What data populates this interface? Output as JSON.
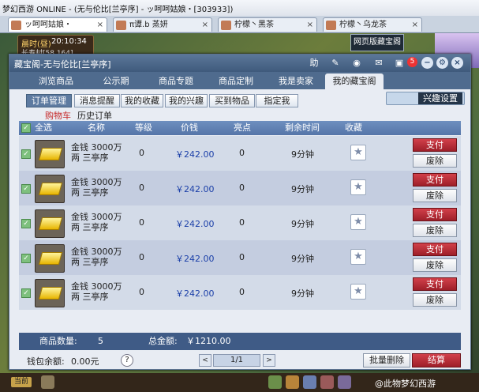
{
  "os_window": {
    "title": "梦幻西游 ONLINE - (无与伦比[兰亭序] - ッ呵呵姑娘・[303933])"
  },
  "game_tabs": [
    {
      "label": "ッ呵呵姑娘・"
    },
    {
      "label": "π谭.b 蒸妍"
    },
    {
      "label": "柠檬丶黑茶"
    },
    {
      "label": "柠檬丶乌龙茶"
    }
  ],
  "hud": {
    "time_label": "晨时(昼)",
    "time": "20:10:34",
    "location": "长寿村[58,164]"
  },
  "top_button": {
    "label": "网页版藏宝阁"
  },
  "window": {
    "title": "藏宝阁-无与伦比[兰亭序]",
    "help_label": "助",
    "notification_count": "5",
    "controls": {
      "minimize": "−",
      "settings": "⚙",
      "close": "×"
    }
  },
  "nav_tabs": [
    "浏览商品",
    "公示期",
    "商品专题",
    "商品定制",
    "我是卖家",
    "我的藏宝阁"
  ],
  "search": {
    "placeholder": ""
  },
  "sub_tabs": [
    "订单管理",
    "消息提醒",
    "我的收藏",
    "我的兴趣",
    "买到物品",
    "指定我"
  ],
  "interest_button": "兴趣设置",
  "order_tabs": [
    "购物车",
    "历史订单"
  ],
  "table": {
    "headers": {
      "select_all": "全选",
      "name": "名称",
      "level": "等级",
      "price": "价钱",
      "highlight": "亮点",
      "remaining": "剩余时间",
      "favorite": "收藏"
    },
    "rows": [
      {
        "name": "金钱 3000万两 三亭序",
        "level": "0",
        "price": "￥242.00",
        "highlight": "0",
        "remaining": "9分钟",
        "pay": "支付",
        "delete": "废除"
      },
      {
        "name": "金钱 3000万两 三亭序",
        "level": "0",
        "price": "￥242.00",
        "highlight": "0",
        "remaining": "9分钟",
        "pay": "支付",
        "delete": "废除"
      },
      {
        "name": "金钱 3000万两 三亭序",
        "level": "0",
        "price": "￥242.00",
        "highlight": "0",
        "remaining": "9分钟",
        "pay": "支付",
        "delete": "废除"
      },
      {
        "name": "金钱 3000万两 三亭序",
        "level": "0",
        "price": "￥242.00",
        "highlight": "0",
        "remaining": "9分钟",
        "pay": "支付",
        "delete": "废除"
      },
      {
        "name": "金钱 3000万两 三亭序",
        "level": "0",
        "price": "￥242.00",
        "highlight": "0",
        "remaining": "9分钟",
        "pay": "支付",
        "delete": "废除"
      }
    ]
  },
  "summary": {
    "count_label": "商品数量:",
    "count": "5",
    "total_label": "总金额:",
    "total": "￥1210.00"
  },
  "wallet": {
    "label": "钱包余额:",
    "value": "0.00元"
  },
  "help_icon": "?",
  "pagination": {
    "prev": "<",
    "page": "1/1",
    "next": ">"
  },
  "batch_delete": "批量删除",
  "checkout": "结算",
  "status_bar": {
    "channel": "当前",
    "watermark": "@此物梦幻西游"
  }
}
